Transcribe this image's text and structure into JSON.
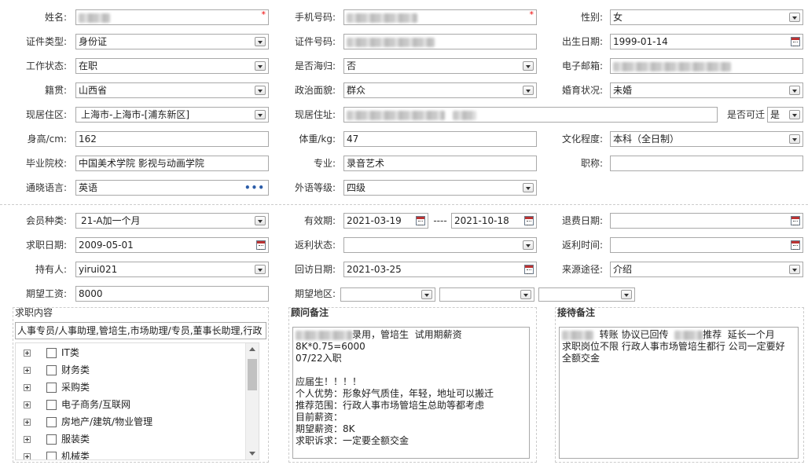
{
  "basic": {
    "name": {
      "label": "姓名:",
      "value": ""
    },
    "phone": {
      "label": "手机号码:",
      "value": ""
    },
    "gender": {
      "label": "性别:",
      "value": "女"
    },
    "id_type": {
      "label": "证件类型:",
      "value": "身份证"
    },
    "id_number": {
      "label": "证件号码:",
      "value": ""
    },
    "birth_date": {
      "label": "出生日期:",
      "value": "1999-01-14"
    },
    "work_status": {
      "label": "工作状态:",
      "value": "在职"
    },
    "overseas": {
      "label": "是否海归:",
      "value": "否"
    },
    "email": {
      "label": "电子邮箱:",
      "value": ""
    },
    "native_place": {
      "label": "籍贯:",
      "value": "山西省"
    },
    "political": {
      "label": "政治面貌:",
      "value": "群众"
    },
    "marital": {
      "label": "婚育状况:",
      "value": "未婚"
    },
    "current_region": {
      "label": "现居住区:",
      "value": "上海市-上海市-[浦东新区]"
    },
    "current_address": {
      "label": "现居住址:",
      "value": ""
    },
    "relocate": {
      "label": "是否可迁",
      "value": "是"
    },
    "height": {
      "label": "身高/cm:",
      "value": "162"
    },
    "weight": {
      "label": "体重/kg:",
      "value": "47"
    },
    "education": {
      "label": "文化程度:",
      "value": "本科（全日制）"
    },
    "school": {
      "label": "毕业院校:",
      "value": "中国美术学院 影视与动画学院"
    },
    "major": {
      "label": "专业:",
      "value": "录音艺术"
    },
    "title": {
      "label": "职称:",
      "value": ""
    },
    "language": {
      "label": "通晓语言:",
      "value": "英语"
    },
    "lang_level": {
      "label": "外语等级:",
      "value": "四级"
    }
  },
  "membership": {
    "member_type": {
      "label": "会员种类:",
      "value": "21-A加一个月"
    },
    "valid_period": {
      "label": "有效期:",
      "from": "2021-03-19",
      "separator": "----",
      "to": "2021-10-18"
    },
    "refund_date": {
      "label": "退费日期:",
      "value": ""
    },
    "job_date": {
      "label": "求职日期:",
      "value": "2009-05-01"
    },
    "rebate_status": {
      "label": "返利状态:",
      "value": ""
    },
    "rebate_time": {
      "label": "返利时间:",
      "value": ""
    },
    "holder": {
      "label": "持有人:",
      "value": "yirui021"
    },
    "visit_date": {
      "label": "回访日期:",
      "value": "2021-03-25"
    },
    "source": {
      "label": "来源途径:",
      "value": "介绍"
    },
    "expected_salary": {
      "label": "期望工资:",
      "value": "8000"
    },
    "expected_area": {
      "label": "期望地区:",
      "value": ""
    }
  },
  "job_content": {
    "title": "求职内容",
    "selected": "人事专员/人事助理,管培生,市场助理/专员,董事长助理,行政",
    "categories": [
      "IT类",
      "财务类",
      "采购类",
      "电子商务/互联网",
      "房地产/建筑/物业管理",
      "服装类",
      "机械类"
    ]
  },
  "consultant_notes": {
    "title": "顾问备注",
    "line1": "录用，管培生  试用期薪资8K*0.75=6000",
    "rest": "07/22入职\n\n应届生！！！！\n个人优势：形象好气质佳，年轻，地址可以搬迁\n推荐范围：行政人事市场管培生总助等都考虑\n目前薪资：\n期望薪资：8K\n求职诉求：一定要全额交金"
  },
  "reception_notes": {
    "title": "接待备注",
    "part1": "转账 协议已回传",
    "part2": "推荐  延长一个月",
    "rest": "求职岗位不限 行政人事市场管培生都行 公司一定要好\n全额交金"
  }
}
